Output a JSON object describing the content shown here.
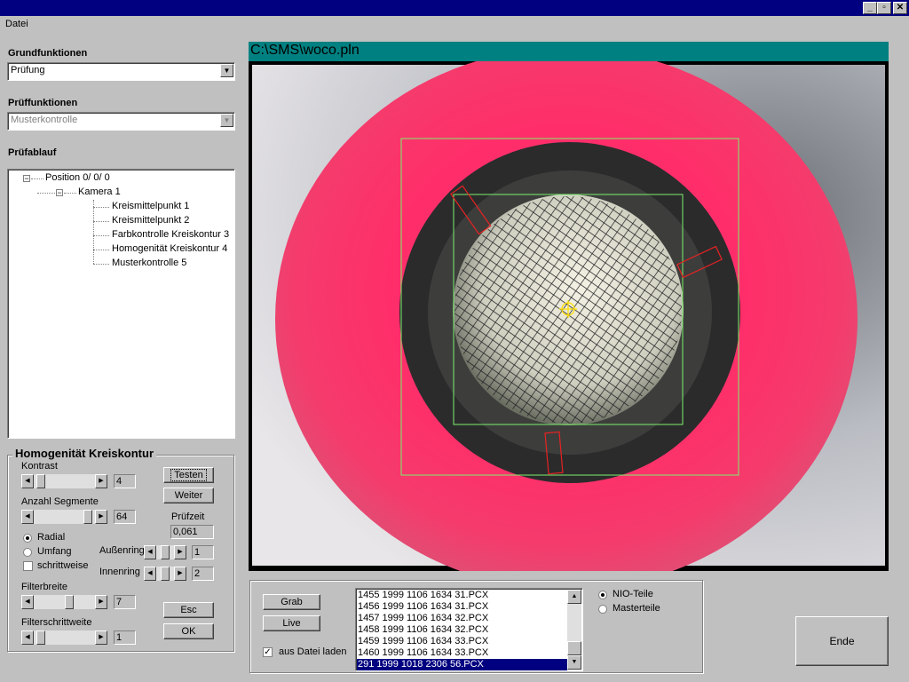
{
  "window": {
    "minimize_icon": "minimize-icon",
    "restore_icon": "restore-icon",
    "close_icon": "close-icon"
  },
  "menu": {
    "datei": "Datei"
  },
  "left": {
    "grundfunktionen_label": "Grundfunktionen",
    "grundfunktionen_value": "Prüfung",
    "prueffunktionen_label": "Prüffunktionen",
    "prueffunktionen_value": "Musterkontrolle",
    "pruefablauf_label": "Prüfablauf",
    "tree": {
      "position": "Position  0/ 0/ 0",
      "kamera": "Kamera  1",
      "items": [
        "Kreismittelpunkt 1",
        "Kreismittelpunkt 2",
        "Farbkontrolle Kreiskontur 3",
        "Homogenität Kreiskontur 4",
        "Musterkontrolle 5"
      ]
    }
  },
  "group": {
    "title": "Homogenität Kreiskontur",
    "kontrast_label": "Kontrast",
    "kontrast_value": "4",
    "anzahl_label": "Anzahl Segmente",
    "anzahl_value": "64",
    "testen": "Testen",
    "weiter": "Weiter",
    "pruefzeit_label": "Prüfzeit",
    "pruefzeit_value": "0,061",
    "radial": "Radial",
    "umfang": "Umfang",
    "schrittweise": "schrittweise",
    "aussenring_label": "Außenring",
    "aussenring_value": "1",
    "innenring_label": "Innenring",
    "innenring_value": "2",
    "filterbreite_label": "Filterbreite",
    "filterbreite_value": "7",
    "filterschrittweite_label": "Filterschrittweite",
    "filterschrittweite_value": "1",
    "esc": "Esc",
    "ok": "OK"
  },
  "image_panel": {
    "title": "C:\\SMS\\woco.pln",
    "title_bg": "#008080"
  },
  "bottom": {
    "grab": "Grab",
    "live": "Live",
    "aus_datei_laden": "aus Datei laden",
    "files": [
      "1455 1999 1106 1634 31.PCX",
      "1456 1999 1106 1634 31.PCX",
      "1457 1999 1106 1634 32.PCX",
      "1458 1999 1106 1634 32.PCX",
      "1459 1999 1106 1634 33.PCX",
      "1460 1999 1106 1634 33.PCX",
      "291 1999 1018 2306 56.PCX"
    ],
    "selected_file": "291 1999 1018 2306 56.PCX",
    "nio_teile": "NIO-Teile",
    "masterteile": "Masterteile",
    "ende": "Ende"
  },
  "sliders": {
    "kontrast": 0.05,
    "anzahl": 0.95,
    "aussenring": 0.5,
    "innenring": 0.5,
    "filterbreite": 0.6,
    "filterschrittweite": 0.05
  }
}
